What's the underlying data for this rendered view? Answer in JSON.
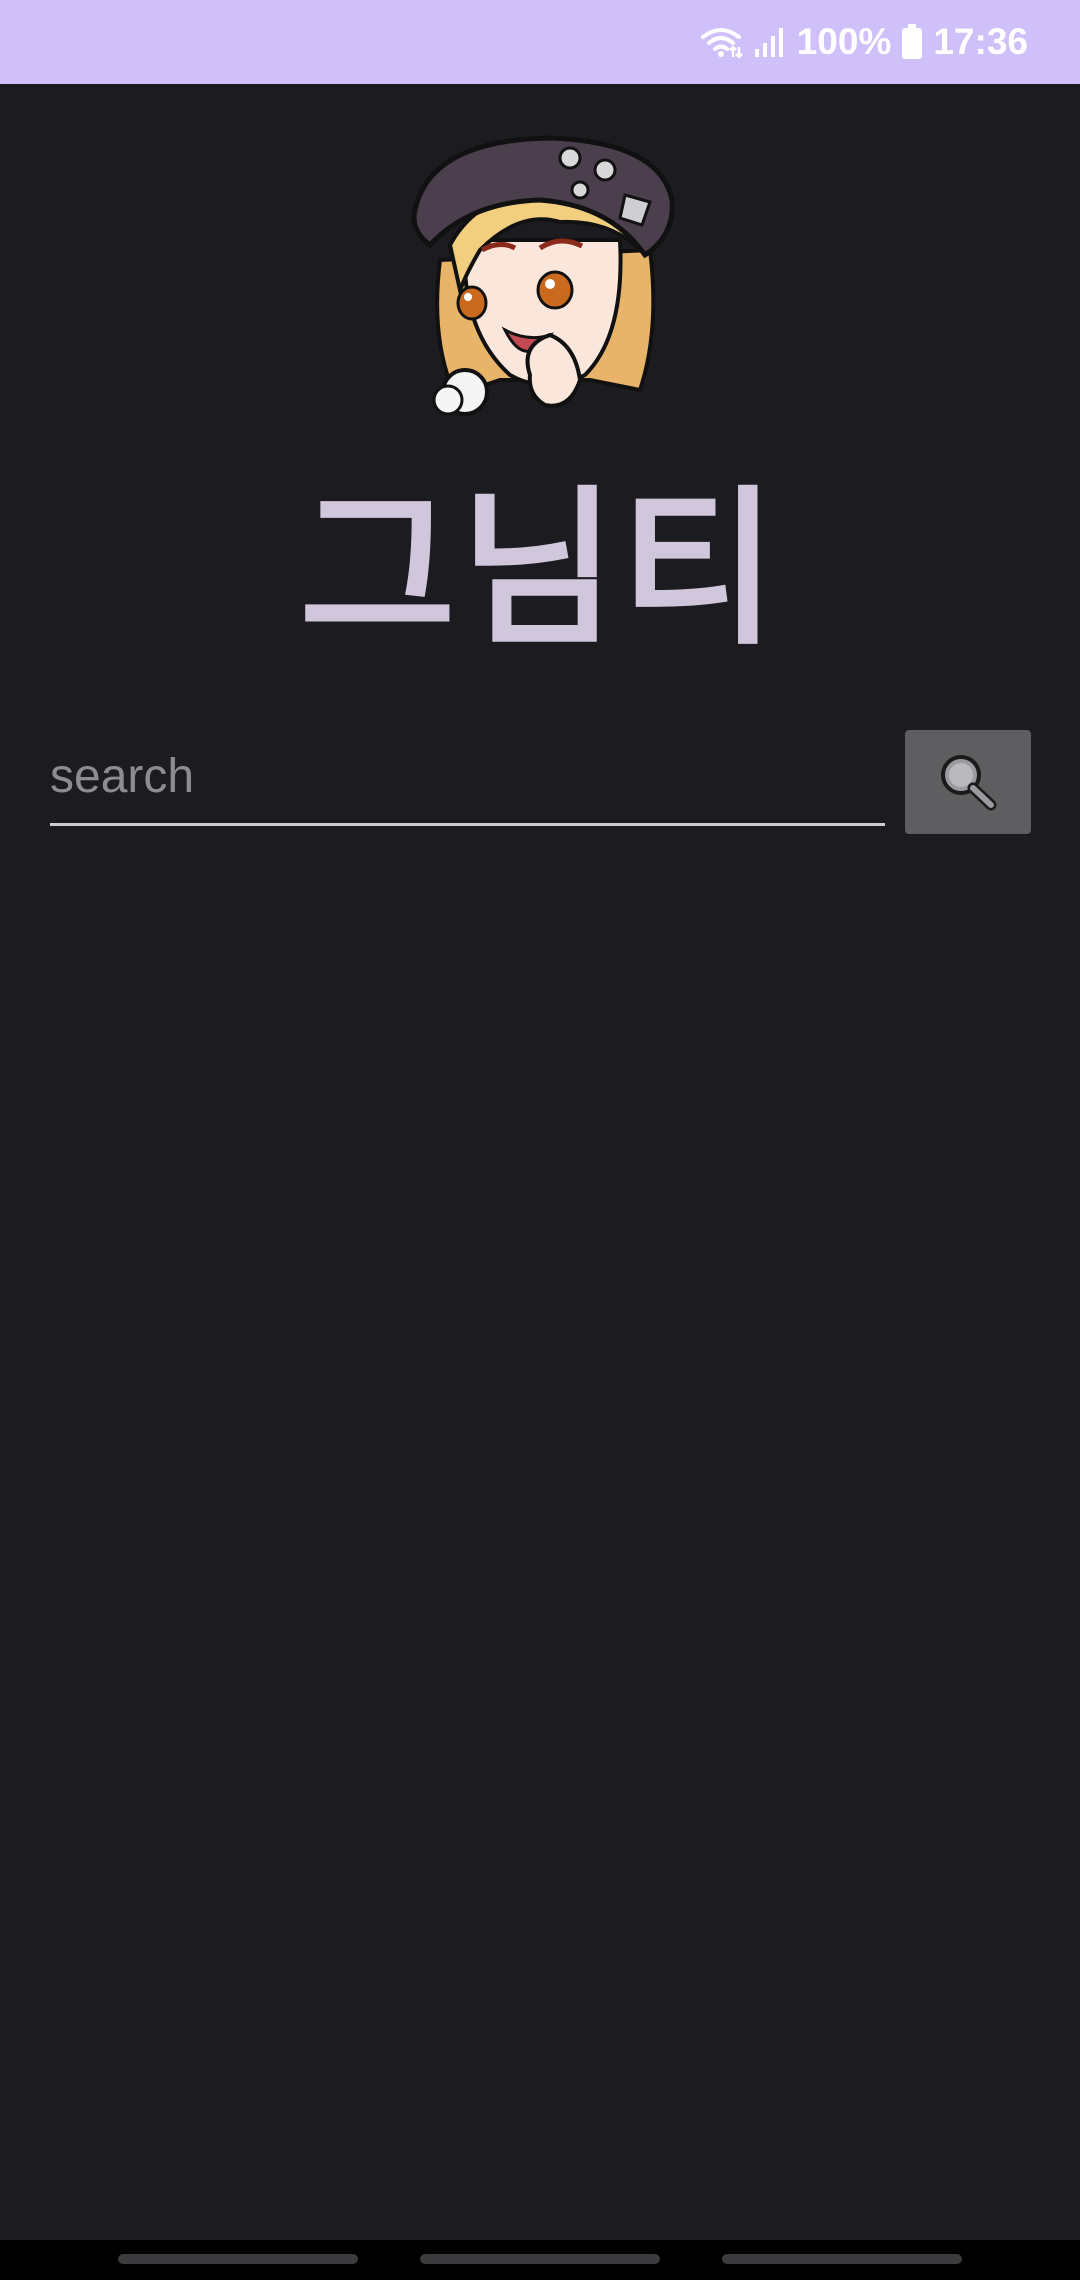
{
  "status_bar": {
    "battery_level": "100%",
    "time": "17:36",
    "background_color": "#cfc0fa",
    "icons": [
      "wifi-icon",
      "signal-icon",
      "battery-icon"
    ]
  },
  "app": {
    "title": "그님티",
    "title_color": "#d1c7dc",
    "background_color": "#1c1b20"
  },
  "search": {
    "placeholder": "search",
    "value": "",
    "button_icon": "search-icon"
  },
  "nav_bar": {
    "handles": 3
  }
}
